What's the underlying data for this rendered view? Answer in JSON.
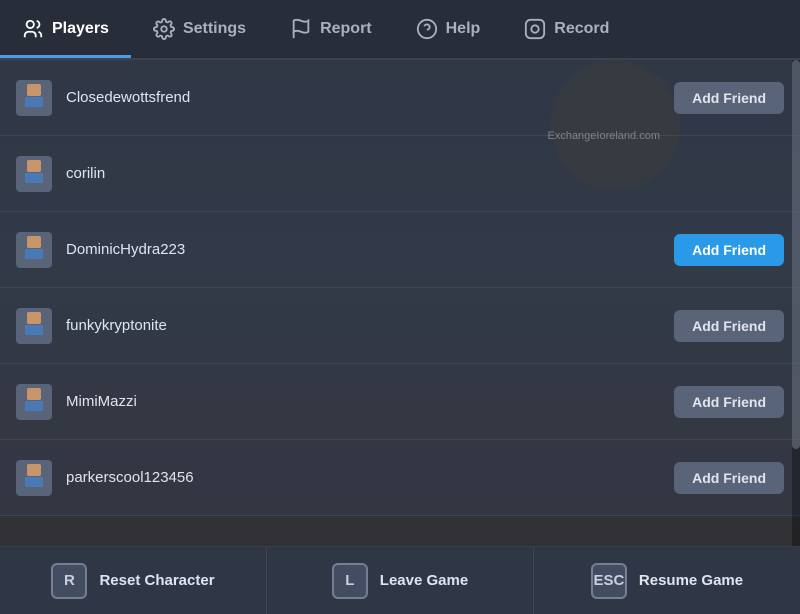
{
  "nav": {
    "items": [
      {
        "id": "players",
        "label": "Players",
        "icon": "👥",
        "active": true
      },
      {
        "id": "settings",
        "label": "Settings",
        "icon": "⚙️",
        "active": false
      },
      {
        "id": "report",
        "label": "Report",
        "icon": "🚩",
        "active": false
      },
      {
        "id": "help",
        "label": "Help",
        "icon": "❓",
        "active": false
      },
      {
        "id": "record",
        "label": "Record",
        "icon": "⊙",
        "active": false
      }
    ]
  },
  "players": [
    {
      "name": "Closedewottsfrend",
      "has_add_friend": true,
      "highlighted": false
    },
    {
      "name": "corilin",
      "has_add_friend": false,
      "highlighted": false
    },
    {
      "name": "DominicHydra223",
      "has_add_friend": true,
      "highlighted": true
    },
    {
      "name": "funkykryptonite",
      "has_add_friend": true,
      "highlighted": false
    },
    {
      "name": "MimiMazzi",
      "has_add_friend": true,
      "highlighted": false
    },
    {
      "name": "parkerscool123456",
      "has_add_friend": true,
      "highlighted": false
    }
  ],
  "add_friend_label": "Add Friend",
  "watermark": "ExchangeIoreland.com",
  "actions": [
    {
      "key": "R",
      "label": "Reset Character"
    },
    {
      "key": "L",
      "label": "Leave Game"
    },
    {
      "key": "ESC",
      "label": "Resume Game"
    }
  ]
}
